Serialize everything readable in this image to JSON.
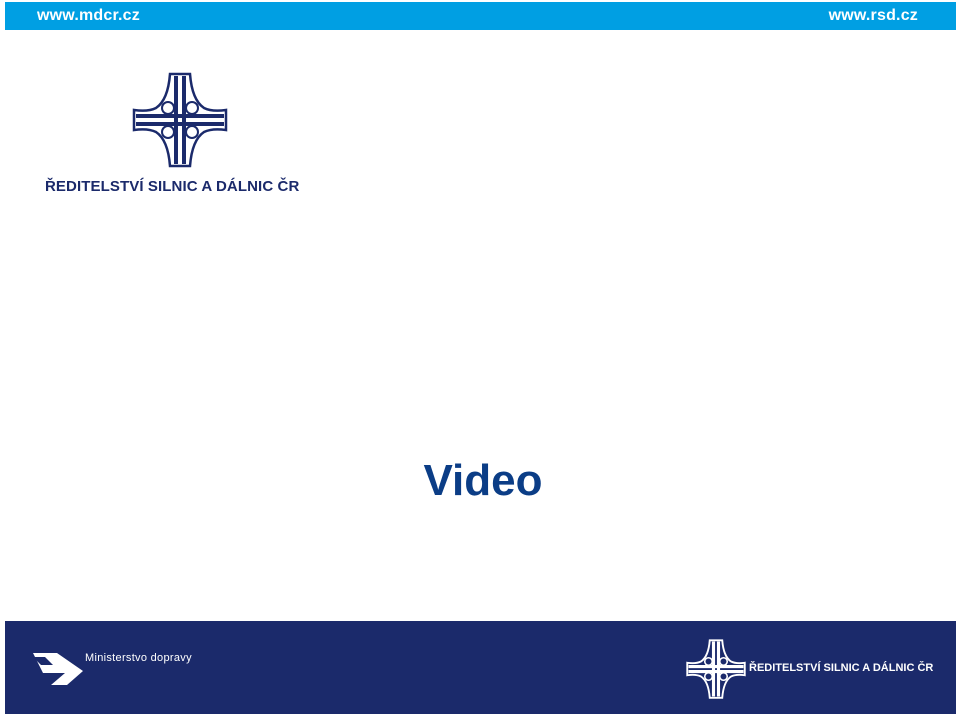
{
  "header": {
    "left_link": "www.mdcr.cz",
    "right_link": "www.rsd.cz",
    "bar_color": "#009fe3"
  },
  "branding": {
    "org_name": "ŘEDITELSTVÍ SILNIC A DÁLNIC ČR",
    "logo_icon": "motorway-interchange-logo-icon",
    "brand_color": "#1b2a6b"
  },
  "slide": {
    "title": "Video",
    "title_color": "#0b3d86"
  },
  "footer": {
    "ministry_name": "Ministerstvo dopravy",
    "ministry_icon": "ministry-arrow-logo-icon",
    "org_name": "ŘEDITELSTVÍ SILNIC A DÁLNIC ČR",
    "bar_color": "#1b2a6b"
  }
}
